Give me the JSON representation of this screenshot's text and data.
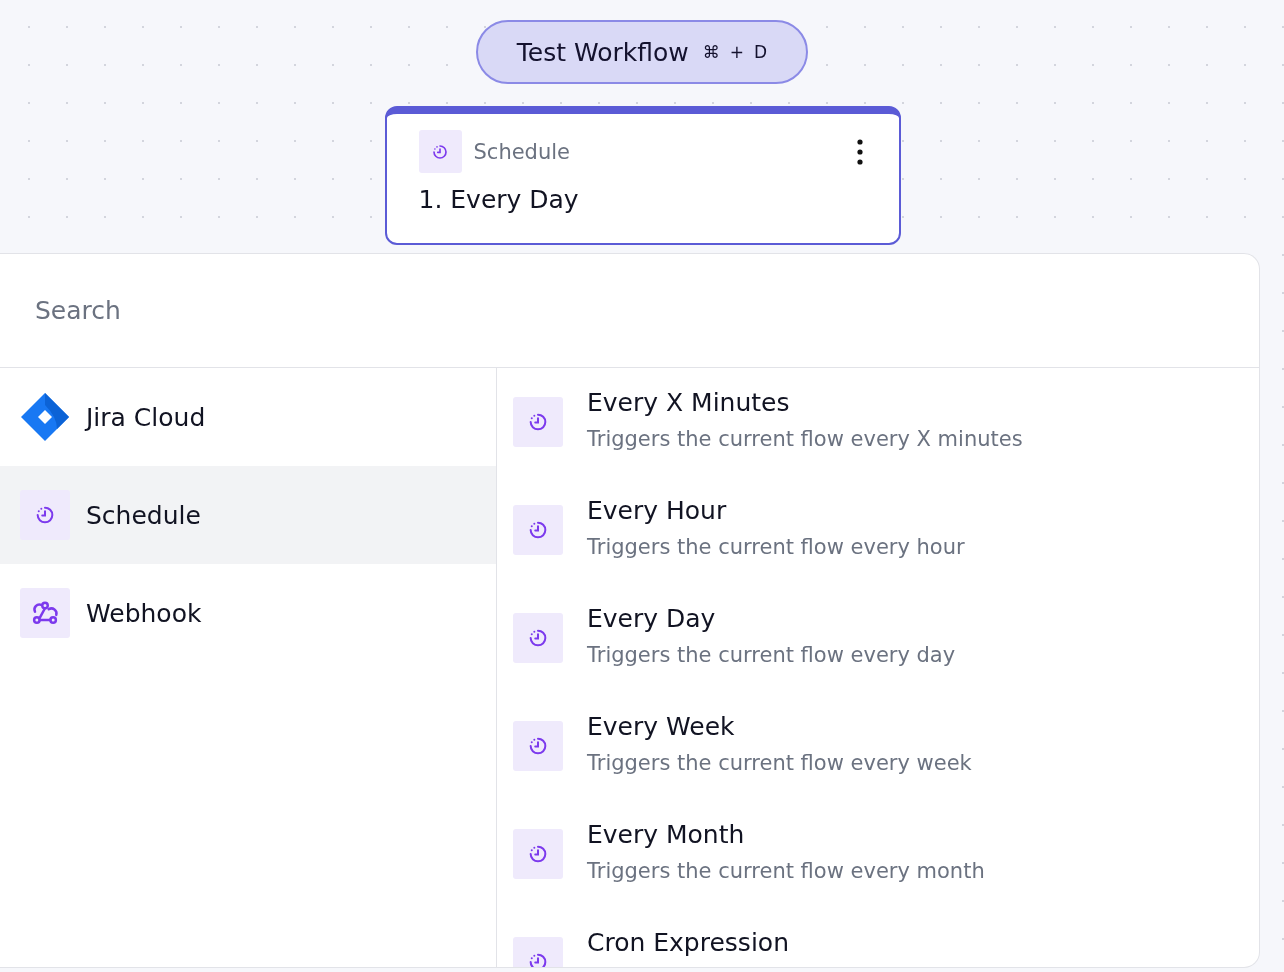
{
  "test_button": {
    "label": "Test Workflow",
    "shortcut_keys": [
      "⌘",
      "+",
      "D"
    ]
  },
  "step_node": {
    "app": "Schedule",
    "title": "1. Every Day"
  },
  "search": {
    "placeholder": "Search"
  },
  "apps": [
    {
      "kind": "jira",
      "label": "Jira Cloud",
      "selected": false
    },
    {
      "kind": "schedule",
      "label": "Schedule",
      "selected": true
    },
    {
      "kind": "webhook",
      "label": "Webhook",
      "selected": false
    }
  ],
  "triggers": [
    {
      "title": "Every X Minutes",
      "description": "Triggers the current flow every X minutes"
    },
    {
      "title": "Every Hour",
      "description": "Triggers the current flow every hour"
    },
    {
      "title": "Every Day",
      "description": "Triggers the current flow every day"
    },
    {
      "title": "Every Week",
      "description": "Triggers the current flow every week"
    },
    {
      "title": "Every Month",
      "description": "Triggers the current flow every month"
    },
    {
      "title": "Cron Expression"
    }
  ]
}
